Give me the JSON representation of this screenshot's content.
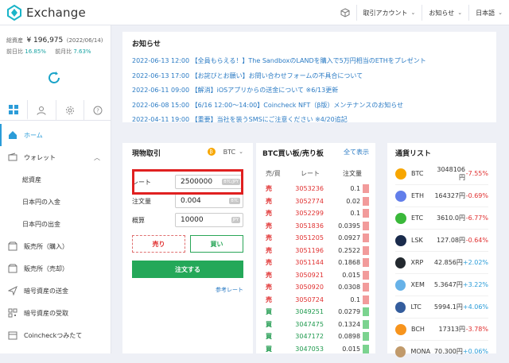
{
  "header": {
    "app_name": "Exchange",
    "account_label": "取引アカウント",
    "notice_label": "お知らせ",
    "lang_label": "日本語"
  },
  "balance": {
    "total_label": "総資産",
    "total_value": "¥ 196,975",
    "total_date": "(2022/06/14)",
    "prev_label": "前日比",
    "prev_value": "16.85%",
    "prev_month_label": "前月比",
    "prev_month_value": "7.63%"
  },
  "menu": {
    "home": "ホーム",
    "wallet": "ウォレット",
    "total": "総資産",
    "jpy_in": "日本円の入金",
    "jpy_out": "日本円の出金",
    "shop_buy": "販売所（購入）",
    "shop_sell": "販売所（売却）",
    "crypto_send": "暗号資産の送金",
    "crypto_recv": "暗号資産の受取",
    "tsumitate": "Coincheckつみたて"
  },
  "news": {
    "title": "お知らせ",
    "items": [
      "2022-06-13 12:00 【全員もらえる！】The SandboxのLANDを購入で5万円相当のETHをプレゼント",
      "2022-06-13 17:00 【お詫びとお願い】お問い合わせフォームの不具合について",
      "2022-06-11 09:00 【解消】iOSアプリからの送金について ※6/13更新",
      "2022-06-08 15:00 【6/16 12:00〜14:00】Coincheck NFT（β版）メンテナンスのお知らせ",
      "2022-04-11 19:00 【重要】当社を装うSMSにご注意ください ※4/20追記"
    ]
  },
  "trade": {
    "title": "現物取引",
    "coin": "BTC",
    "rate_label": "レート",
    "rate_value": "2500000",
    "rate_unit": "BTC/JPY",
    "amount_label": "注文量",
    "amount_value": "0.004",
    "amount_unit": "BTC",
    "approx_label": "概算",
    "approx_value": "10000",
    "approx_unit": "JPY",
    "sell": "売り",
    "buy": "買い",
    "order": "注文する",
    "ref_rate": "参考レート"
  },
  "book": {
    "title": "BTC買い板/売り板",
    "show_all": "全て表示",
    "col_side": "売/買",
    "col_rate": "レート",
    "col_qty": "注文量",
    "asks": [
      [
        "売",
        "3053236",
        "0.1"
      ],
      [
        "売",
        "3052774",
        "0.02"
      ],
      [
        "売",
        "3052299",
        "0.1"
      ],
      [
        "売",
        "3051836",
        "0.0395"
      ],
      [
        "売",
        "3051205",
        "0.0927"
      ],
      [
        "売",
        "3051196",
        "0.2522"
      ],
      [
        "売",
        "3051144",
        "0.1868"
      ],
      [
        "売",
        "3050921",
        "0.015"
      ],
      [
        "売",
        "3050920",
        "0.0308"
      ],
      [
        "売",
        "3050724",
        "0.1"
      ]
    ],
    "bids": [
      [
        "買",
        "3049251",
        "0.0279"
      ],
      [
        "買",
        "3047475",
        "0.1324"
      ],
      [
        "買",
        "3047172",
        "0.0898"
      ],
      [
        "買",
        "3047053",
        "0.015"
      ]
    ]
  },
  "rates": {
    "title": "通貨リスト",
    "items": [
      {
        "sym": "BTC",
        "price": "3048106円",
        "chg": "-7.55%",
        "color": "#f7a600"
      },
      {
        "sym": "ETH",
        "price": "164327円",
        "chg": "-0.69%",
        "color": "#627eea"
      },
      {
        "sym": "ETC",
        "price": "3610.0円",
        "chg": "-6.77%",
        "color": "#3ab83a"
      },
      {
        "sym": "LSK",
        "price": "127.08円",
        "chg": "-0.64%",
        "color": "#1a2b4c"
      },
      {
        "sym": "XRP",
        "price": "42.856円",
        "chg": "+2.02%",
        "color": "#23292f"
      },
      {
        "sym": "XEM",
        "price": "5.3647円",
        "chg": "+3.22%",
        "color": "#67b2e8"
      },
      {
        "sym": "LTC",
        "price": "5994.1円",
        "chg": "+4.06%",
        "color": "#345d9d"
      },
      {
        "sym": "BCH",
        "price": "17313円",
        "chg": "-3.78%",
        "color": "#f7941d"
      },
      {
        "sym": "MONA",
        "price": "70.300円",
        "chg": "+0.06%",
        "color": "#c19a6b"
      }
    ]
  }
}
